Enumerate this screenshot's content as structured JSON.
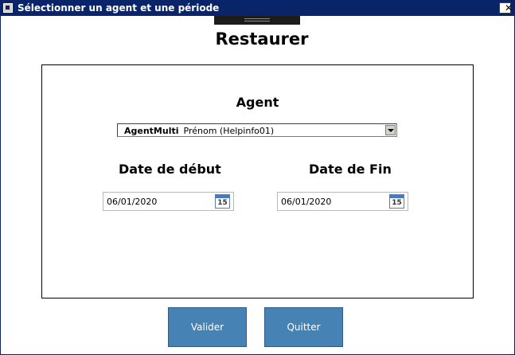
{
  "window": {
    "title": "Sélectionner un agent et une période",
    "close_glyph": "✕"
  },
  "heading": "Restaurer",
  "form": {
    "agent_label": "Agent",
    "agent_select": {
      "selected_bold": "AgentMulti",
      "selected_rest": "Prénom (Helpinfo01)"
    },
    "start_date": {
      "label": "Date de début",
      "value": "06/01/2020",
      "calendar_icon": "calendar-icon",
      "calendar_day": "15"
    },
    "end_date": {
      "label": "Date de Fin",
      "value": "06/01/2020",
      "calendar_icon": "calendar-icon",
      "calendar_day": "15"
    }
  },
  "buttons": {
    "validate": "Valider",
    "quit": "Quitter"
  },
  "colors": {
    "titlebar": "#0a246a",
    "button": "#4682b4",
    "calendar_accent": "#4a78b8"
  }
}
